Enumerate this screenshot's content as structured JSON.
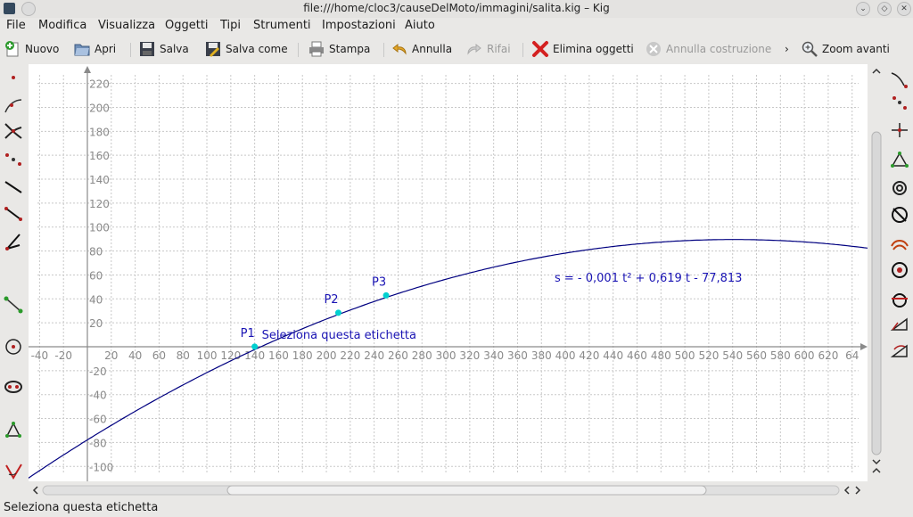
{
  "window": {
    "title": "file:///home/cloc3/causeDelMoto/immagini/salita.kig – Kig"
  },
  "menu": [
    "File",
    "Modifica",
    "Visualizza",
    "Oggetti",
    "Tipi",
    "Strumenti",
    "Impostazioni",
    "Aiuto"
  ],
  "toolbar": {
    "new": "Nuovo",
    "open": "Apri",
    "save": "Salva",
    "save_as": "Salva come",
    "print": "Stampa",
    "undo": "Annulla",
    "redo": "Rifai",
    "delete": "Elimina oggetti",
    "cancel": "Annulla costruzione",
    "more": "›",
    "zoom_in": "Zoom avanti"
  },
  "canvas": {
    "x_ticks": [
      "-40",
      "-20",
      "20",
      "40",
      "60",
      "80",
      "100",
      "120",
      "140",
      "160",
      "180",
      "200",
      "220",
      "240",
      "260",
      "280",
      "300",
      "320",
      "340",
      "360",
      "380",
      "400",
      "420",
      "440",
      "460",
      "480",
      "500",
      "520",
      "540",
      "560",
      "580",
      "600",
      "620",
      "64"
    ],
    "y_ticks": [
      "220",
      "200",
      "180",
      "160",
      "140",
      "120",
      "100",
      "80",
      "60",
      "40",
      "20",
      "-20",
      "-40",
      "-60",
      "-80",
      "-100"
    ],
    "points": [
      {
        "label": "P1",
        "x": 140,
        "y": 0.1
      },
      {
        "label": "P2",
        "x": 210,
        "y": 28.4
      },
      {
        "label": "P3",
        "x": 250,
        "y": 42.9
      }
    ],
    "label_text": "Seleziona questa etichetta",
    "equation": "s = - 0,001 t² + 0,619 t - 77,813",
    "curve": {
      "a": -0.0005722,
      "b": 0.619,
      "c": -77.813
    },
    "colors": {
      "curve": "#000080",
      "point": "#00d0d0",
      "text": "#1a14b4",
      "grid": "#c8c8c8",
      "axis": "#8a8a8a"
    }
  },
  "status": "Seleziona questa etichetta"
}
